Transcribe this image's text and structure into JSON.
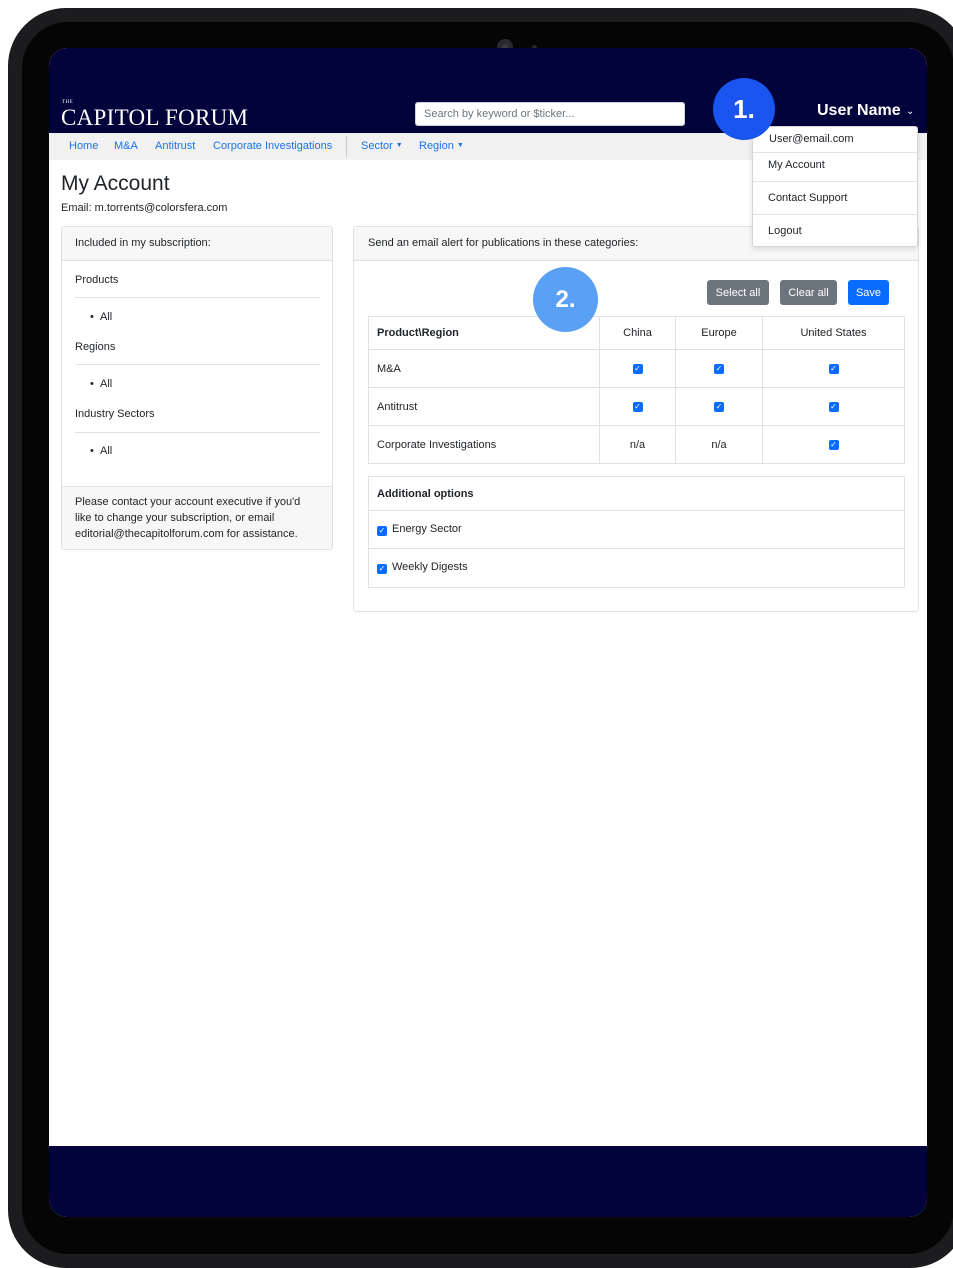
{
  "header": {
    "logo_small": "THE",
    "logo_text": "CAPITOL FORUM",
    "search_placeholder": "Search by keyword or $ticker...",
    "user_name": "User Name",
    "user_caret": "⌄"
  },
  "nav": {
    "items": [
      "Home",
      "M&A",
      "Antitrust",
      "Corporate Investigations"
    ],
    "dropdowns": [
      "Sector",
      "Region"
    ],
    "caret": "▼"
  },
  "user_menu": {
    "email": "User@email.com",
    "items": [
      "My Account",
      "Contact Support",
      "Logout"
    ]
  },
  "page": {
    "title": "My Account",
    "email_line": "Email: m.torrents@colorsfera.com"
  },
  "subscription": {
    "header": "Included in my subscription:",
    "sections": [
      {
        "title": "Products",
        "items": [
          "All"
        ]
      },
      {
        "title": "Regions",
        "items": [
          "All"
        ]
      },
      {
        "title": "Industry Sectors",
        "items": [
          "All"
        ]
      }
    ],
    "bullet": "•",
    "footer": "Please contact your account executive if you'd like to change your subscription,  or email editorial@thecapitolforum.com for assistance."
  },
  "alerts": {
    "header": "Send an email alert for publications in these categories:",
    "buttons": {
      "select_all": "Select all",
      "clear_all": "Clear all",
      "save": "Save"
    },
    "table": {
      "columns": [
        "Product\\Region",
        "China",
        "Europe",
        "United States"
      ],
      "rows": [
        {
          "label": "M&A",
          "cells": [
            "checked",
            "checked",
            "checked"
          ]
        },
        {
          "label": "Antitrust",
          "cells": [
            "checked",
            "checked",
            "checked"
          ]
        },
        {
          "label": "Corporate Investigations",
          "cells": [
            "n/a",
            "n/a",
            "checked"
          ]
        }
      ]
    },
    "additional": {
      "title": "Additional options",
      "options": [
        {
          "label": "Energy Sector",
          "checked": true
        },
        {
          "label": "Weekly Digests",
          "checked": true
        }
      ]
    }
  },
  "markers": {
    "one": "1.",
    "two": "2."
  },
  "checkmark": "✓",
  "colors": {
    "navy": "#02033a",
    "link": "#1a73e8",
    "primary": "#0a6cff",
    "secondary": "#6c757d",
    "marker1": "#1a55f0",
    "marker2": "#5aa0f5"
  }
}
